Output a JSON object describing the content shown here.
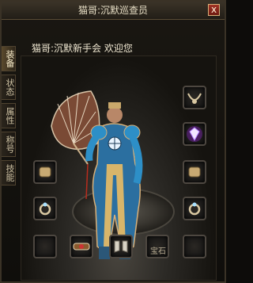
{
  "window": {
    "title": "猫哥:沉默巡查员",
    "close_label": "x"
  },
  "greeting": "猫哥:沉默新手会 欢迎您",
  "tabs": [
    {
      "label": "装备"
    },
    {
      "label": "状态"
    },
    {
      "label": "属性"
    },
    {
      "label": "称号"
    },
    {
      "label": "技能"
    }
  ],
  "slots": {
    "bottom_right_text": "宝石"
  },
  "colors": {
    "accent": "#a23324",
    "gold": "#d7b07a",
    "robe": "#2b6fa0"
  }
}
